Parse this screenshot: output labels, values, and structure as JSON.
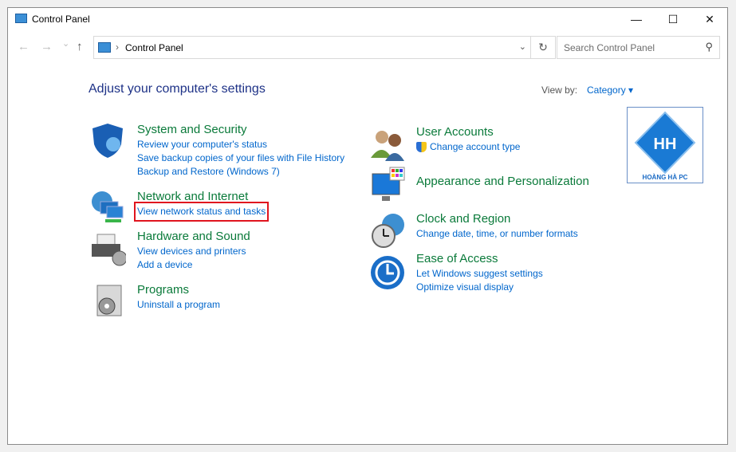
{
  "window": {
    "title": "Control Panel",
    "minimize": "—",
    "maximize": "☐",
    "close": "✕"
  },
  "address": {
    "crumb": "Control Panel",
    "refresh": "↻",
    "dropdown": "⌄"
  },
  "nav": {
    "back": "←",
    "forward": "→",
    "recent": "⌄",
    "up": "↑"
  },
  "search": {
    "placeholder": "Search Control Panel",
    "icon": "⚲"
  },
  "heading": "Adjust your computer's settings",
  "view_by": {
    "label": "View by:",
    "value": "Category ▾"
  },
  "logo": {
    "text": "HOÀNG HÀ PC"
  },
  "left": [
    {
      "title": "System and Security",
      "links": [
        "Review your computer's status",
        "Save backup copies of your files with File History",
        "Backup and Restore (Windows 7)"
      ]
    },
    {
      "title": "Network and Internet",
      "links": [
        "View network status and tasks"
      ]
    },
    {
      "title": "Hardware and Sound",
      "links": [
        "View devices and printers",
        "Add a device"
      ]
    },
    {
      "title": "Programs",
      "links": [
        "Uninstall a program"
      ]
    }
  ],
  "right": [
    {
      "title": "User Accounts",
      "links": [
        "Change account type"
      ]
    },
    {
      "title": "Appearance and Personalization",
      "links": []
    },
    {
      "title": "Clock and Region",
      "links": [
        "Change date, time, or number formats"
      ]
    },
    {
      "title": "Ease of Access",
      "links": [
        "Let Windows suggest settings",
        "Optimize visual display"
      ]
    }
  ]
}
